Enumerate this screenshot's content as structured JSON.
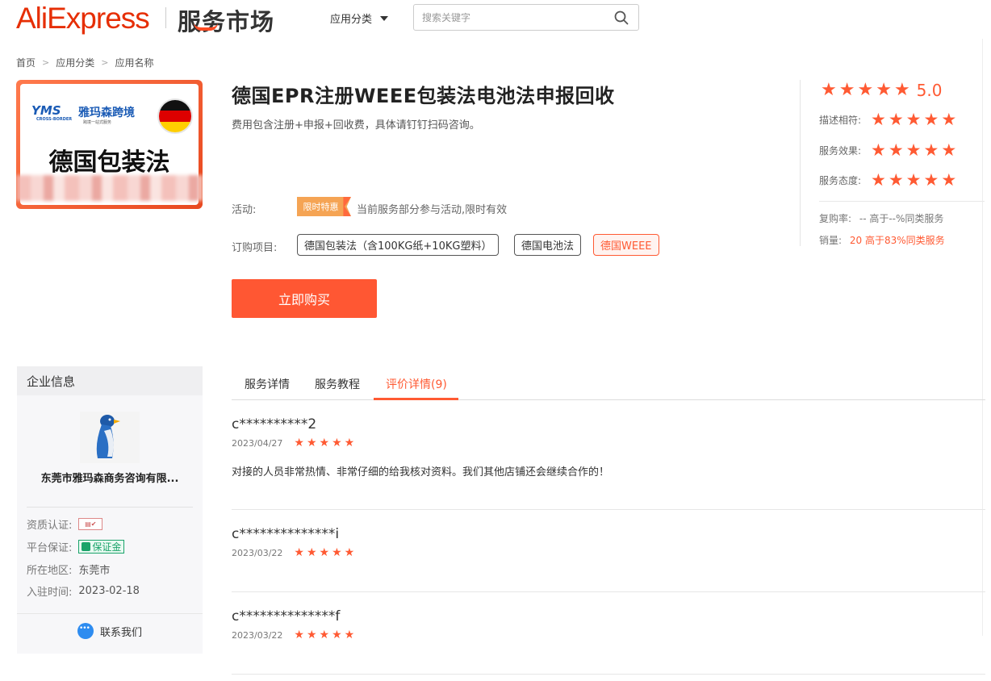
{
  "header": {
    "brand": "AliExpress",
    "subtitle": "服务市场",
    "category_label": "应用分类",
    "search_placeholder": "搜索关键字"
  },
  "breadcrumb": [
    "首页",
    "应用分类",
    "应用名称"
  ],
  "product_image": {
    "logo_left": "YMS",
    "logo_left_sub": "CROSS-BORDER",
    "logo_right": "雅玛森跨境",
    "logo_right_sub": "跨境一站式服务",
    "label": "德国包装法"
  },
  "product": {
    "title": "德国EPR注册WEEE包装法电池法申报回收",
    "description": "费用包含注册+申报+回收费，具体请钉钉扫码咨询。",
    "activity_label": "活动:",
    "activity_badge": "限时特惠",
    "activity_text": "当前服务部分参与活动,限时有效",
    "options_label": "订购项目:",
    "options": [
      {
        "label": "德国包装法（含100KG纸+10KG塑料）",
        "selected": false
      },
      {
        "label": "德国电池法",
        "selected": false
      },
      {
        "label": "德国WEEE",
        "selected": true
      }
    ],
    "buy_label": "立即购买"
  },
  "rating": {
    "overall": "5.0",
    "overall_stars": 5,
    "rows": [
      {
        "label": "描述相符:",
        "stars": 5
      },
      {
        "label": "服务效果:",
        "stars": 5
      },
      {
        "label": "服务态度:",
        "stars": 5
      }
    ],
    "repurchase_label": "复购率:",
    "repurchase_value": "-- 高于--%同类服务",
    "sales_label": "销量:",
    "sales_value": "20 高于83%同类服务"
  },
  "company": {
    "header": "企业信息",
    "name": "东莞市雅玛森商务咨询有限...",
    "cert_label": "资质认证:",
    "guarantee_label": "平台保证:",
    "guarantee_value": "保证金",
    "region_label": "所在地区:",
    "region_value": "东莞市",
    "join_label": "入驻时间:",
    "join_value": "2023-02-18",
    "contact_label": "联系我们"
  },
  "tabs": [
    {
      "label": "服务详情",
      "active": false
    },
    {
      "label": "服务教程",
      "active": false
    },
    {
      "label": "评价详情(9)",
      "active": true
    }
  ],
  "reviews": [
    {
      "user": "c**********2",
      "date": "2023/04/27",
      "stars": 5,
      "text": "对接的人员非常热情、非常仔细的给我核对资料。我们其他店铺还会继续合作的！"
    },
    {
      "user": "c**************i",
      "date": "2023/03/22",
      "stars": 5,
      "text": ""
    },
    {
      "user": "c**************f",
      "date": "2023/03/22",
      "stars": 5,
      "text": ""
    }
  ],
  "colors": {
    "accent": "#ff5733",
    "brand": "#e62e04",
    "star": "#ff5a33",
    "guarantee": "#1aa36a"
  }
}
